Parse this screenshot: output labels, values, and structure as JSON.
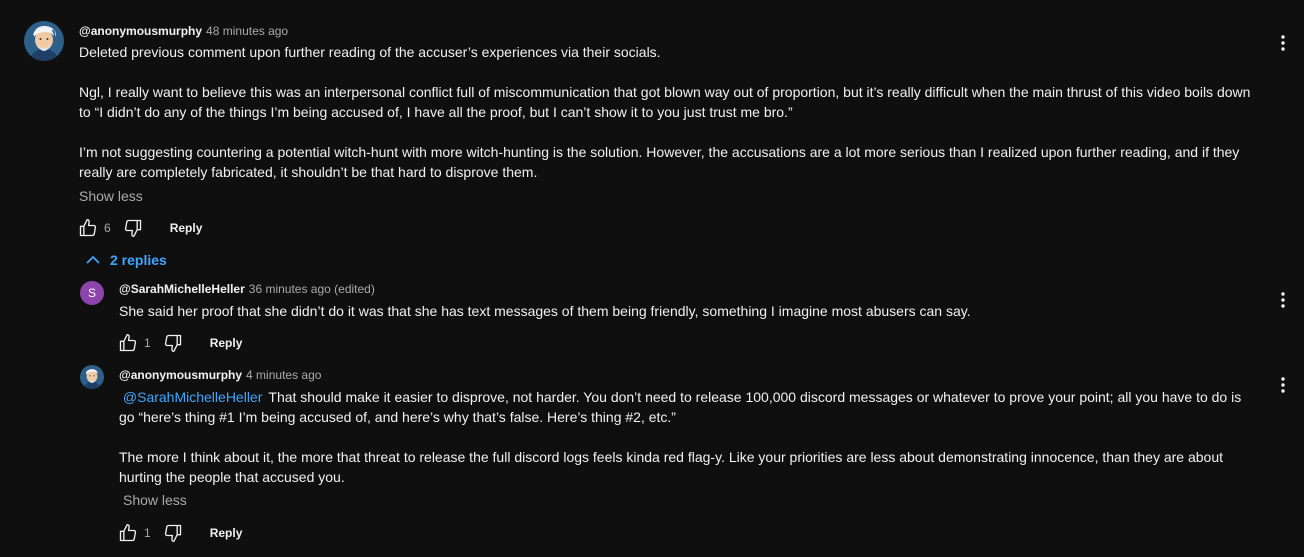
{
  "comments": {
    "main": {
      "author": "@anonymousmurphy",
      "time": "48 minutes ago",
      "paragraphs": [
        "Deleted previous comment upon further reading of the accuser’s experiences via their socials.",
        "Ngl, I really want to believe this was an interpersonal conflict full of miscommunication that got blown way out of proportion, but it’s really difficult when the main thrust of this video boils down to “I didn’t do any of the things I’m being accused of, I have all the proof, but I can’t show it to you just trust me bro.”",
        "I’m not suggesting countering a potential witch-hunt with more witch-hunting is the solution. However, the accusations are a lot more serious than I realized upon further reading, and if they really are completely fabricated, it shouldn’t be that hard to disprove them."
      ],
      "show_less": "Show less",
      "likes": "6",
      "reply_label": "Reply",
      "replies_toggle": "2 replies"
    },
    "reply1": {
      "avatar_letter": "S",
      "author": "@SarahMichelleHeller",
      "time": "36 minutes ago (edited)",
      "text": "She said her proof that she didn’t do it was that she has text messages of them being friendly, something I imagine most abusers can say.",
      "likes": "1",
      "reply_label": "Reply"
    },
    "reply2": {
      "author": "@anonymousmurphy",
      "time": "4 minutes ago",
      "mention": "@SarahMichelleHeller",
      "text1": "That should make it easier to disprove, not harder. You don’t need to release 100,000 discord messages or whatever to prove your point; all you have to do is go “here’s thing #1 I’m being accused of, and here’s why that’s false. Here’s thing #2, etc.”",
      "text2": "The more I think about it, the more that threat to release the full discord logs feels kinda red flag-y. Like your priorities are less about demonstrating innocence, than they are about hurting the people that accused you.",
      "show_less": "Show less",
      "likes": "1",
      "reply_label": "Reply"
    }
  },
  "colors": {
    "background": "#0f0f0f",
    "text": "#f1f1f1",
    "secondary_text": "#aaaaaa",
    "link": "#3ea6ff",
    "letter_avatar": "#8e44ad"
  },
  "icons": [
    "avatar-cartoon-icon",
    "thumbs-up-icon",
    "thumbs-down-icon",
    "more-vertical-icon",
    "chevron-up-icon"
  ]
}
